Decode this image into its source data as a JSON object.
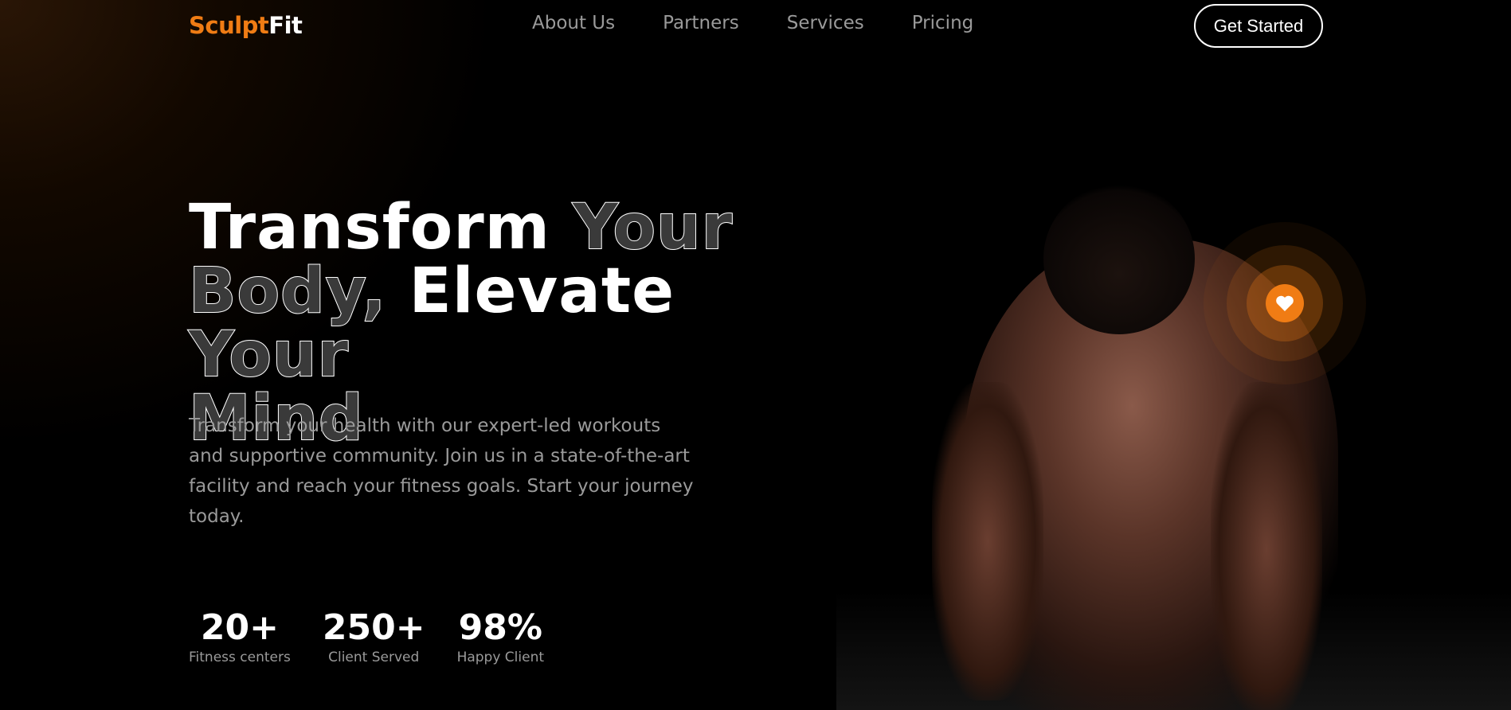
{
  "header": {
    "logo_part1": "Sculpt",
    "logo_part2": "Fit",
    "nav": [
      {
        "label": "About Us"
      },
      {
        "label": "Partners"
      },
      {
        "label": "Services"
      },
      {
        "label": "Pricing"
      }
    ],
    "cta_label": "Get Started"
  },
  "hero": {
    "title_w1": "Transform",
    "title_w2": "Your",
    "title_w3": "Body,",
    "title_w4": "Elevate",
    "title_w5": "Your",
    "title_w6": "Mind",
    "description": "Transform your health with our expert-led workouts and supportive community. Join us in a state-of-the-art facility and reach your fitness goals. Start your journey today.",
    "badge_icon": "heart-icon",
    "accent": "#f07c14"
  },
  "stats": [
    {
      "value": "20+",
      "label": "Fitness centers"
    },
    {
      "value": "250+",
      "label": "Client Served"
    },
    {
      "value": "98%",
      "label": "Happy Client"
    }
  ]
}
